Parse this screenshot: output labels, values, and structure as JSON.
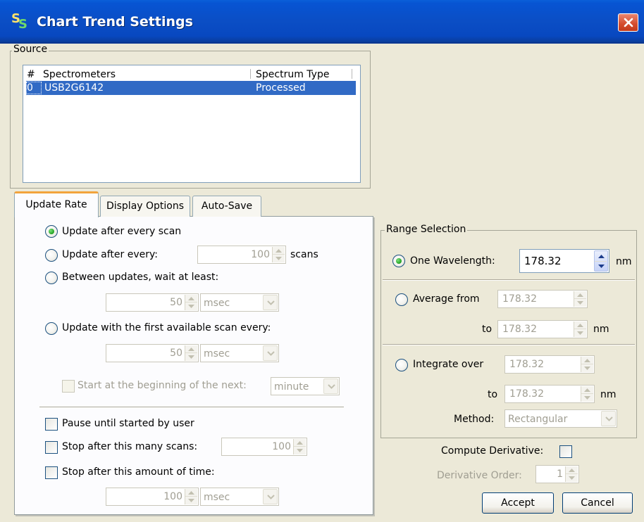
{
  "window": {
    "title": "Chart Trend Settings",
    "icon_letters": [
      "S",
      "S"
    ]
  },
  "source": {
    "legend": "Source",
    "columns": [
      "#",
      "Spectrometers",
      "Spectrum Type"
    ],
    "rows": [
      {
        "index": "0",
        "spectrometer": "USB2G6142",
        "spectrum_type": "Processed",
        "selected": true
      }
    ]
  },
  "tabs": [
    {
      "label": "Update Rate",
      "active": true
    },
    {
      "label": "Display Options",
      "active": false
    },
    {
      "label": "Auto-Save",
      "active": false
    }
  ],
  "update_rate": {
    "every_scan_label": "Update after every scan",
    "every_n_label": "Update after every:",
    "every_n_value": "100",
    "every_n_unit": "scans",
    "wait_label": "Between updates, wait at least:",
    "wait_value": "50",
    "wait_unit": "msec",
    "first_available_label": "Update with the first available scan every:",
    "first_available_value": "50",
    "first_available_unit": "msec",
    "start_next_label": "Start at the beginning of the next:",
    "start_next_unit": "minute",
    "pause_label": "Pause until started by user",
    "stop_scans_label": "Stop after this many scans:",
    "stop_scans_value": "100",
    "stop_time_label": "Stop after this amount of time:",
    "stop_time_value": "100",
    "stop_time_unit": "msec",
    "selected": "every_scan"
  },
  "range": {
    "legend": "Range Selection",
    "one_label": "One Wavelength:",
    "one_value": "178.32",
    "one_unit": "nm",
    "avg_label": "Average from",
    "avg_from": "178.32",
    "avg_to_label": "to",
    "avg_to": "178.32",
    "avg_unit": "nm",
    "int_label": "Integrate over",
    "int_from": "178.32",
    "int_to_label": "to",
    "int_to": "178.32",
    "int_unit": "nm",
    "method_label": "Method:",
    "method_value": "Rectangular",
    "selected": "one"
  },
  "derivative": {
    "compute_label": "Compute Derivative:",
    "order_label": "Derivative Order:",
    "order_value": "1"
  },
  "buttons": {
    "accept": "Accept",
    "cancel": "Cancel"
  }
}
